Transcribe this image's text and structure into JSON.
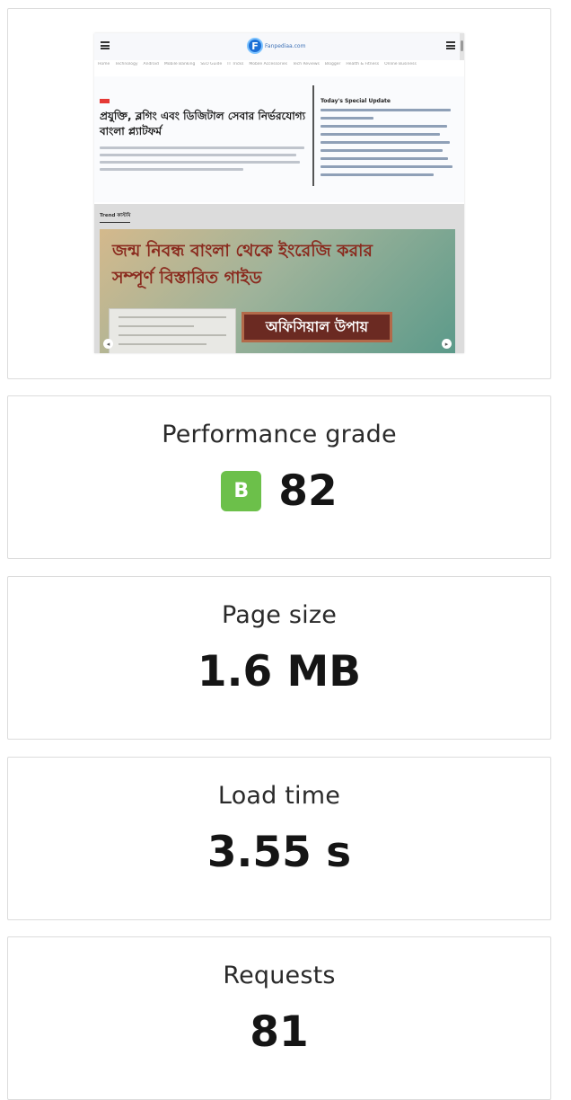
{
  "screenshot": {
    "logo_text": "Fanpediaa.com",
    "nav_items": [
      "Home",
      "Technology",
      "Android",
      "Mobile Banking",
      "SEO Guide",
      "IT Tricks",
      "Mobile Accessories",
      "Tech Reviews",
      "Blogger",
      "Health & Fitness",
      "Online Business"
    ],
    "hero_title": "প্রযুক্তি, ব্লগিং এবং ডিজিটাল সেবার নির্ভরযোগ্য বাংলা প্ল্যাটফর্ম",
    "side_title": "Today's Special Update",
    "section_label": "Trend কাস্টমি",
    "banner_line1": "জন্ম নিবন্ধ বাংলা থেকে ইংরেজি করার",
    "banner_line2": "সম্পূর্ণ বিস্তারিত গাইড",
    "banner_pill": "অফিসিয়াল উপায়",
    "prev_arrow": "◂",
    "next_arrow": "▸"
  },
  "metrics": {
    "performance": {
      "label": "Performance grade",
      "grade": "B",
      "value": "82"
    },
    "page_size": {
      "label": "Page size",
      "value": "1.6 MB"
    },
    "load_time": {
      "label": "Load time",
      "value": "3.55 s"
    },
    "requests": {
      "label": "Requests",
      "value": "81"
    }
  },
  "colors": {
    "grade_badge": "#6cc04a",
    "card_border": "#dcdcdc"
  }
}
